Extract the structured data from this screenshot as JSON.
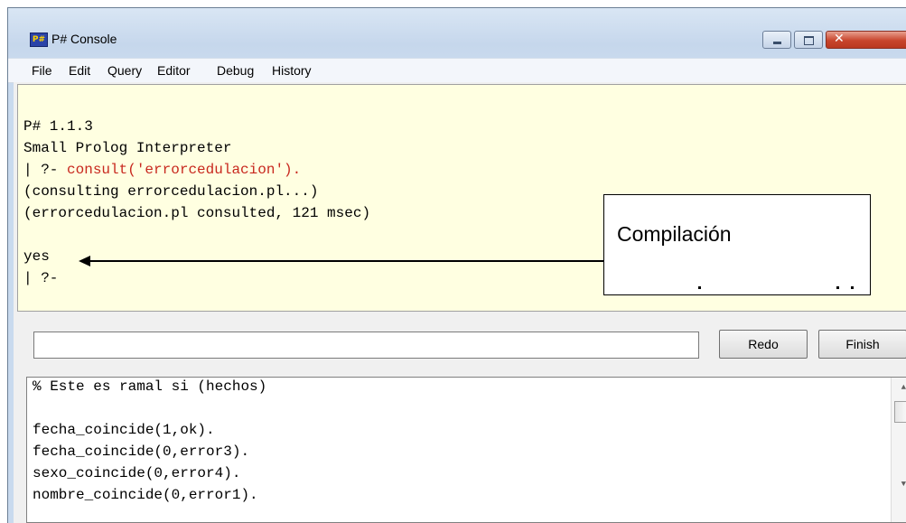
{
  "window": {
    "title": "P# Console",
    "icon_label": "P#",
    "close_glyph": "✕"
  },
  "menu": [
    "File",
    "Edit",
    "Query",
    "Editor",
    "Debug",
    "History"
  ],
  "console": {
    "lines": [
      "P# 1.1.3",
      "Small Prolog Interpreter",
      "| ?- ",
      "(consulting errorcedulacion.pl...)",
      "(errorcedulacion.pl consulted, 121 msec)",
      "",
      "yes",
      "| ?-"
    ],
    "query_highlight": "consult('errorcedulacion')."
  },
  "query_input": {
    "value": ""
  },
  "buttons": {
    "redo": "Redo",
    "finish": "Finish"
  },
  "editor": {
    "lines": [
      "% Este es ramal si (hechos)",
      "",
      "fecha_coincide(1,ok).",
      "fecha_coincide(0,error3).",
      "sexo_coincide(0,error4).",
      "nombre_coincide(0,error1)."
    ]
  },
  "callout": {
    "text": "Compilación"
  },
  "colors": {
    "console_bg": "#ffffe1",
    "query_red": "#c8281e",
    "close_red": "#c8452c"
  },
  "icons": [
    "app-icon",
    "minimize-icon",
    "maximize-icon",
    "close-icon",
    "scroll-up-icon",
    "scroll-down-icon",
    "arrow-left-icon"
  ]
}
